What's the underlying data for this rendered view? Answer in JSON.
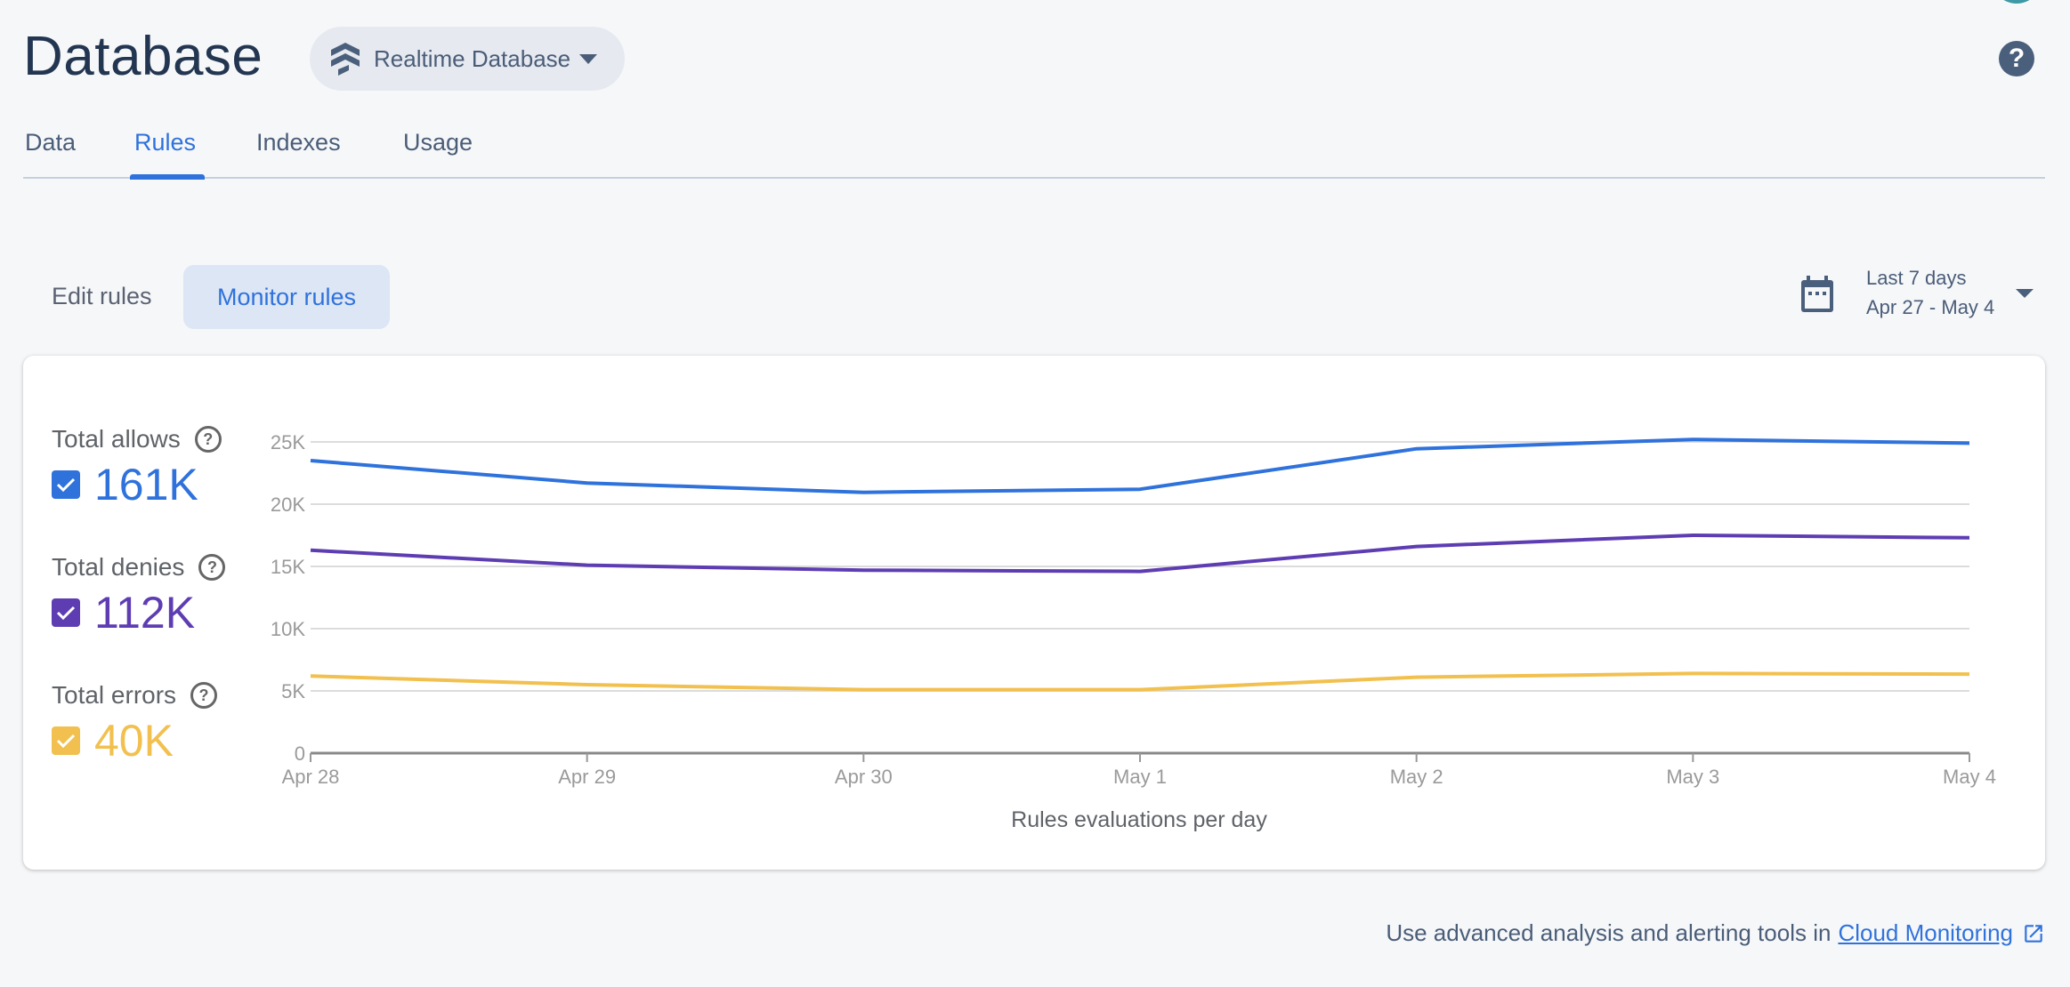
{
  "header": {
    "title": "Database",
    "db_selector": "Realtime Database",
    "help_icon": "help-circle-icon"
  },
  "tabs": [
    {
      "label": "Data"
    },
    {
      "label": "Rules",
      "active": true
    },
    {
      "label": "Indexes"
    },
    {
      "label": "Usage"
    }
  ],
  "mode": {
    "edit": "Edit rules",
    "monitor": "Monitor rules",
    "selected": "Monitor rules"
  },
  "date_range": {
    "label": "Last 7 days",
    "range": "Apr 27 - May 4",
    "icon": "calendar-icon"
  },
  "legend": [
    {
      "label": "Total allows",
      "value": "161K",
      "color": "#2f72dc",
      "checked": true
    },
    {
      "label": "Total denies",
      "value": "112K",
      "color": "#5e3db3",
      "checked": true
    },
    {
      "label": "Total errors",
      "value": "40K",
      "color": "#f2c04e",
      "checked": true
    }
  ],
  "chart_data": {
    "type": "line",
    "xlabel": "Rules evaluations per day",
    "ylabel": "",
    "categories": [
      "Apr 28",
      "Apr 29",
      "Apr 30",
      "May 1",
      "May 2",
      "May 3",
      "May 4"
    ],
    "yticks": [
      "0",
      "5K",
      "10K",
      "15K",
      "20K",
      "25K"
    ],
    "ylim": [
      0,
      25000
    ],
    "grid": true,
    "series": [
      {
        "name": "Total allows",
        "color": "#2f72dc",
        "values": [
          23500,
          21700,
          20950,
          21200,
          24450,
          25200,
          24900
        ]
      },
      {
        "name": "Total denies",
        "color": "#5e3db3",
        "values": [
          16300,
          15100,
          14700,
          14600,
          16600,
          17500,
          17300
        ]
      },
      {
        "name": "Total errors",
        "color": "#f2c04e",
        "values": [
          6200,
          5500,
          5100,
          5100,
          6100,
          6400,
          6350
        ]
      }
    ]
  },
  "footer": {
    "text": "Use advanced analysis and alerting tools in",
    "link": "Cloud Monitoring"
  }
}
